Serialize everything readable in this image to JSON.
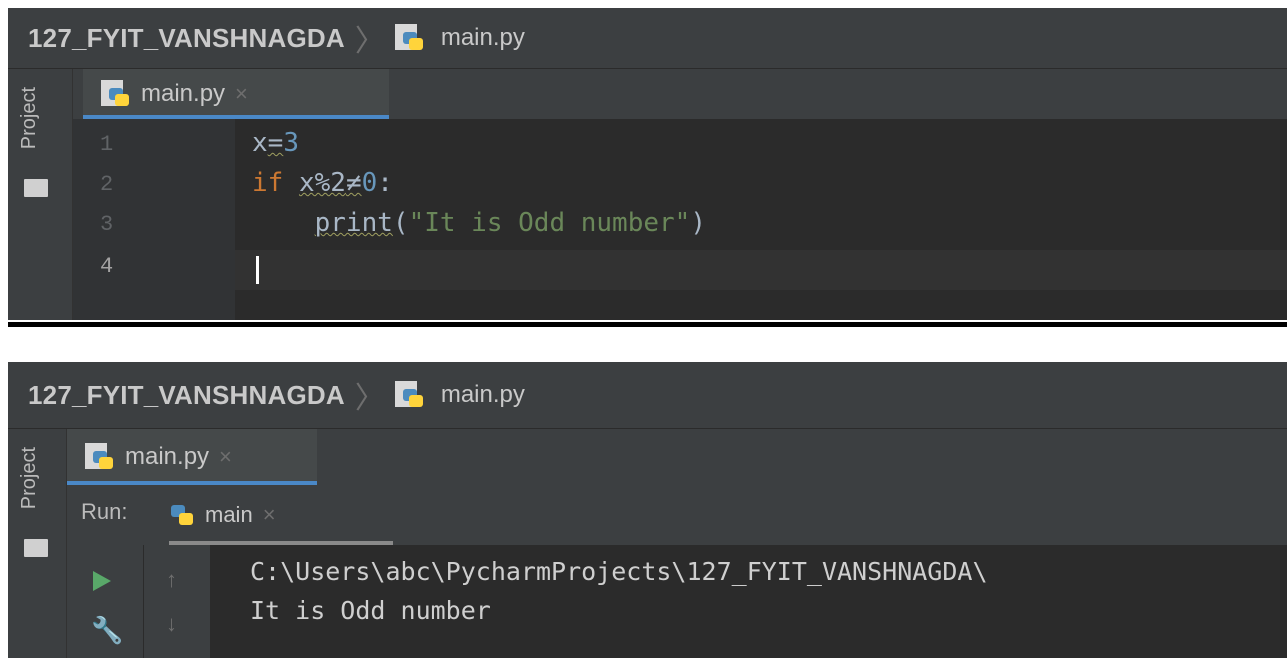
{
  "top_panel": {
    "breadcrumb": {
      "project": "127_FYIT_VANSHNAGDA",
      "file": "main.py"
    },
    "side_label": "Project",
    "editor_tab": {
      "label": "main.py",
      "close": "×"
    },
    "lines": [
      "1",
      "2",
      "3",
      "4"
    ],
    "code": {
      "line1": {
        "var": "x",
        "op": "=",
        "val": "3"
      },
      "line2": {
        "kw": "if",
        "expr": "x%2",
        "op": "≠",
        "val": "0",
        "colon": ":"
      },
      "line3": {
        "indent": "    ",
        "fn": "print",
        "open": "(",
        "str": "\"It is Odd number\"",
        "close": ")"
      }
    }
  },
  "bottom_panel": {
    "breadcrumb": {
      "project": "127_FYIT_VANSHNAGDA",
      "file": "main.py"
    },
    "side_label": "Project",
    "editor_tab": {
      "label": "main.py",
      "close": "×"
    },
    "run": {
      "label": "Run:",
      "tab": "main",
      "close": "×",
      "output": [
        "C:\\Users\\abc\\PycharmProjects\\127_FYIT_VANSHNAGDA\\",
        "It is Odd number"
      ]
    }
  },
  "colors": {
    "editor_bg": "#2b2b2b",
    "keyword": "#cc7832",
    "number": "#6897bb",
    "string": "#6a8759",
    "tab_underline": "#4a88c7",
    "run_icon": "#59a869"
  },
  "icons": [
    "python-file-icon",
    "folder-icon",
    "run-play-icon",
    "wrench-icon",
    "arrow-up-icon",
    "arrow-down-icon"
  ]
}
